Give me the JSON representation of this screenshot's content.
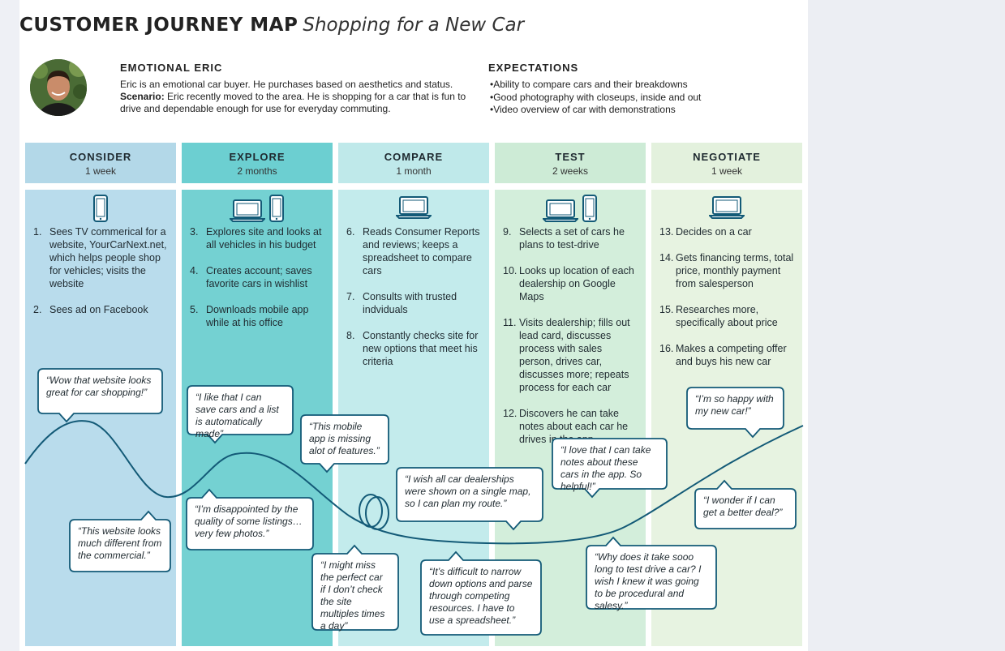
{
  "header": {
    "title": "CUSTOMER JOURNEY MAP",
    "subtitle": "Shopping for a New Car"
  },
  "persona": {
    "name": "EMOTIONAL ERIC",
    "description": "Eric is an emotional car buyer. He purchases based on aesthetics and status.",
    "scenario_label": "Scenario:",
    "scenario": "Eric recently moved to the area. He is shopping for a car that is fun to drive and dependable enough for use for everyday commuting."
  },
  "expectations": {
    "title": "EXPECTATIONS",
    "items": [
      "Ability to compare cars and their breakdowns",
      "Good photography with closeups, inside and out",
      "Video overview of car with demonstrations"
    ]
  },
  "colors": {
    "consider_head": "#b3d8e8",
    "consider_body": "#b9dcec",
    "explore_head": "#6ccfd1",
    "explore_body": "#74d1d2",
    "compare_head": "#bfe9ea",
    "compare_body": "#c3ebec",
    "test_head": "#cdebd6",
    "test_body": "#d3eedb",
    "negotiate_head": "#e3f1dd",
    "negotiate_body": "#e7f3e1",
    "curve": "#135a77"
  },
  "stages": [
    {
      "name": "CONSIDER",
      "duration": "1 week",
      "devices": [
        "phone-icon"
      ],
      "steps": [
        {
          "num": "1.",
          "text": "Sees TV commerical for a website, YourCarNext.net, which helps people shop for vehicles; visits the website"
        },
        {
          "num": "2.",
          "text": "Sees ad on Facebook"
        }
      ]
    },
    {
      "name": "EXPLORE",
      "duration": "2 months",
      "devices": [
        "laptop-icon",
        "phone-icon"
      ],
      "steps": [
        {
          "num": "3.",
          "text": "Explores site and looks at all vehicles in his budget"
        },
        {
          "num": "4.",
          "text": "Creates account; saves favorite cars in wishlist"
        },
        {
          "num": "5.",
          "text": "Downloads mobile app while at his office"
        }
      ]
    },
    {
      "name": "COMPARE",
      "duration": "1 month",
      "devices": [
        "laptop-icon"
      ],
      "steps": [
        {
          "num": "6.",
          "text": "Reads Consumer Reports and reviews; keeps a spreadsheet to compare cars"
        },
        {
          "num": "7.",
          "text": "Consults with trusted indviduals"
        },
        {
          "num": "8.",
          "text": "Constantly checks site for new options that meet his criteria"
        }
      ]
    },
    {
      "name": "TEST",
      "duration": "2 weeks",
      "devices": [
        "laptop-icon",
        "phone-icon"
      ],
      "steps": [
        {
          "num": "9.",
          "text": "Selects a set of cars he plans to test-drive"
        },
        {
          "num": "10.",
          "text": "Looks up location of each dealership on Google Maps"
        },
        {
          "num": "11.",
          "text": "Visits dealership; fills out lead card, discusses process with sales person, drives car, discusses more; repeats process for each car"
        },
        {
          "num": "12.",
          "text": "Discovers he can take notes about each car he drives in the app"
        }
      ]
    },
    {
      "name": "NEGOTIATE",
      "duration": "1 week",
      "devices": [
        "laptop-icon"
      ],
      "steps": [
        {
          "num": "13.",
          "text": "Decides on a car"
        },
        {
          "num": "14.",
          "text": "Gets financing terms, total price, monthly payment from salesperson"
        },
        {
          "num": "15.",
          "text": "Researches more, specifically about price"
        },
        {
          "num": "16.",
          "text": "Makes a competing offer and buys his new car"
        }
      ]
    }
  ],
  "quotes": [
    "“Wow that website looks great for car shopping!”",
    "“This website looks much different from the commercial.”",
    "“I like that I can save cars and a list is automatically made”",
    "“I’m disappointed by the quality of some listings… very few photos.”",
    "“This mobile app is missing alot of features.”",
    "“I might miss the perfect car if I don’t check the site multiples times a day”",
    "“I wish all car dealerships were shown on a single map, so I can plan my route.”",
    "“It’s difficult to narrow down options and parse through competing resources. I have to use a spreadsheet.”",
    "“I love that I can take notes about these cars in the app. So helpful!”",
    "“Why does it take sooo long to test drive a car? I wish I knew it was going to be procedural and salesy.”",
    "“I’m so happy with my new car!”",
    "“I wonder if I can get a better deal?”"
  ]
}
